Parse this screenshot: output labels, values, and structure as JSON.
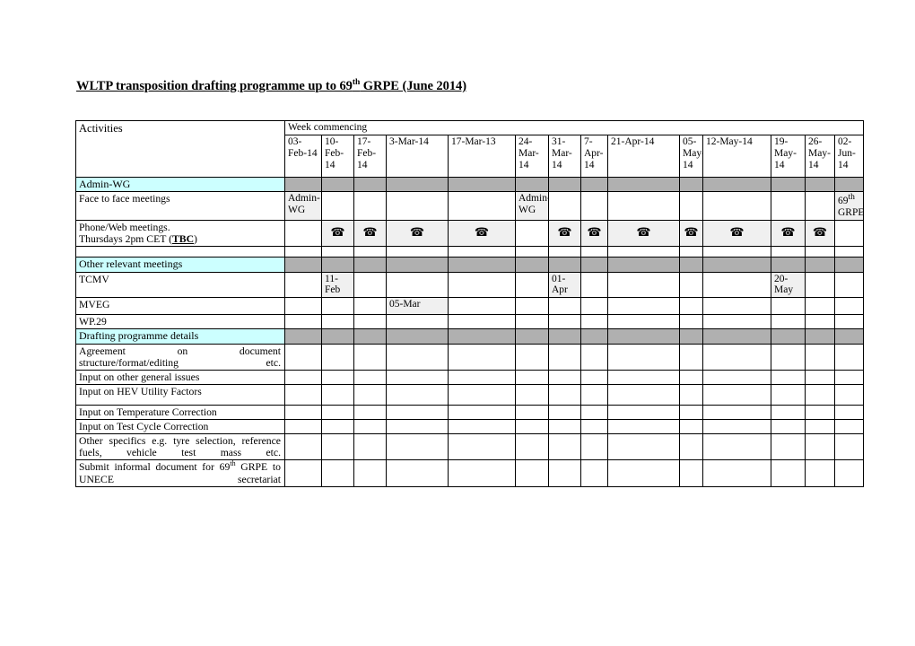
{
  "document": {
    "title_prefix": "WLTP transposition drafting programme up to 69",
    "title_sup": "th",
    "title_suffix": " GRPE (June 2014)"
  },
  "table": {
    "activities_header": "Activities",
    "week_commencing_header": "Week commencing",
    "columns": [
      "03-Feb-14",
      "10-Feb-14",
      "17-Feb-14",
      "3-Mar-14",
      "17-Mar-13",
      "24-Mar-14",
      "31-Mar-14",
      "7-Apr-14",
      "21-Apr-14",
      "05-May-14",
      "12-May-14",
      "19-May-14",
      "26-May-14",
      "02-Jun-14"
    ],
    "sections": {
      "admin_wg": "Admin-WG",
      "other_relevant_meetings": "Other relevant meetings",
      "drafting_programme_details": "Drafting programme details"
    },
    "rows": {
      "face_to_face": "Face to face meetings",
      "phone_web_line1": "Phone/Web meetings.",
      "phone_web_line2_a": "Thursdays 2pm CET (",
      "phone_web_line2_tbc": "TBC",
      "phone_web_line2_b": ")",
      "tcmv": "TCMV",
      "mveg": "MVEG",
      "wp29": "WP.29",
      "agreement_structure": "Agreement on document structure/format/editing etc.",
      "input_general": "Input on other general issues",
      "input_hev": "Input on HEV Utility Factors",
      "input_temperature": "Input on Temperature Correction",
      "input_test_cycle": "Input on Test Cycle Correction",
      "other_specifics": "Other specifics e.g. tyre selection, reference fuels, vehicle test mass etc.",
      "submit_informal_a": "Submit informal document for 69",
      "submit_informal_sup": "th",
      "submit_informal_b": " GRPE to UNECE secretariat"
    },
    "cell_values": {
      "admin_wg_marker": "Admin-WG",
      "grpe_marker_a": "69",
      "grpe_marker_sup": "th",
      "grpe_marker_b": "GRPE",
      "phone_icon": "☎",
      "tcmv_feb": "11-Feb",
      "tcmv_apr": "01-Apr",
      "tcmv_may": "20-May",
      "mveg_mar": "05-Mar"
    }
  },
  "colors": {
    "section_header_bg": "#ccffff",
    "section_fill_bg": "#b0b0b0",
    "marked_cell_bg": "#f0f0f0",
    "border": "#000000",
    "page_bg": "#ffffff"
  }
}
